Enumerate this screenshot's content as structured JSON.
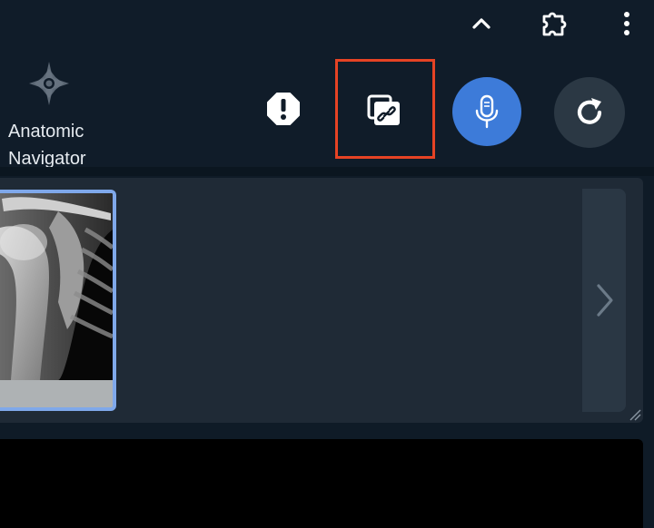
{
  "topbar": {
    "collapse_icon": "chevron-up-icon",
    "extensions_icon": "puzzle-piece-icon",
    "menu_icon": "more-vert-icon"
  },
  "header": {
    "logo_icon": "compass-star-icon",
    "app_name_line1": "Anatomic",
    "app_name_line2": "Navigator",
    "buttons": [
      {
        "name": "report-issue",
        "icon": "exclamation-octagon-icon"
      },
      {
        "name": "copy-link",
        "icon": "link-copy-icon",
        "highlighted": true
      },
      {
        "name": "voice-input",
        "icon": "microphone-icon"
      },
      {
        "name": "refresh",
        "icon": "refresh-icon"
      }
    ]
  },
  "thumbnails": {
    "items": [
      {
        "label": "",
        "image": "x-ray-shoulder",
        "selected": true
      }
    ],
    "next_icon": "chevron-right-icon"
  },
  "colors": {
    "background": "#0f1b27",
    "panel": "#1f2a36",
    "accent_blue": "#3d7bd9",
    "highlight_red": "#e64324",
    "thumb_border": "#7fa8ea"
  }
}
